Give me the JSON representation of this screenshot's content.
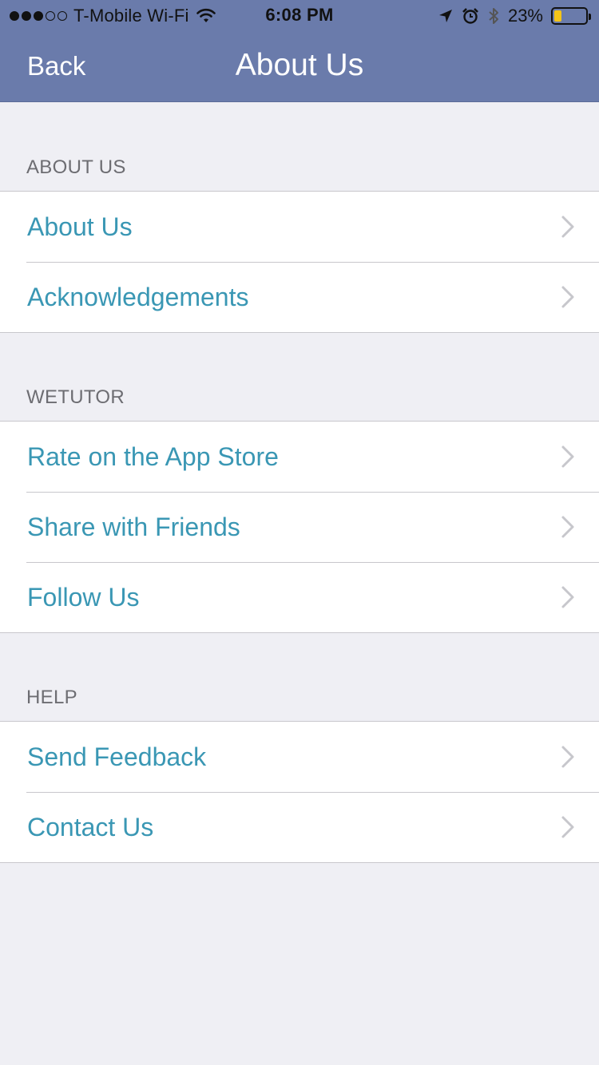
{
  "status_bar": {
    "carrier": "T-Mobile Wi-Fi",
    "time": "6:08 PM",
    "battery_percent": "23%",
    "battery_level": 0.23,
    "signal_bars_filled": 3,
    "signal_bars_total": 5,
    "icons": [
      "wifi-icon",
      "location-arrow-icon",
      "alarm-icon",
      "bluetooth-icon",
      "battery-icon"
    ]
  },
  "nav": {
    "back_label": "Back",
    "title": "About Us"
  },
  "sections": [
    {
      "header": "ABOUT US",
      "items": [
        {
          "label": "About Us"
        },
        {
          "label": "Acknowledgements"
        }
      ]
    },
    {
      "header": "WETUTOR",
      "items": [
        {
          "label": "Rate on the App Store"
        },
        {
          "label": "Share with Friends"
        },
        {
          "label": "Follow Us"
        }
      ]
    },
    {
      "header": "HELP",
      "items": [
        {
          "label": "Send Feedback"
        },
        {
          "label": "Contact Us"
        }
      ]
    }
  ],
  "colors": {
    "nav_background": "#6a7bab",
    "link_text": "#3a97b4",
    "page_background": "#efeff4",
    "battery_fill": "#f5c518"
  }
}
